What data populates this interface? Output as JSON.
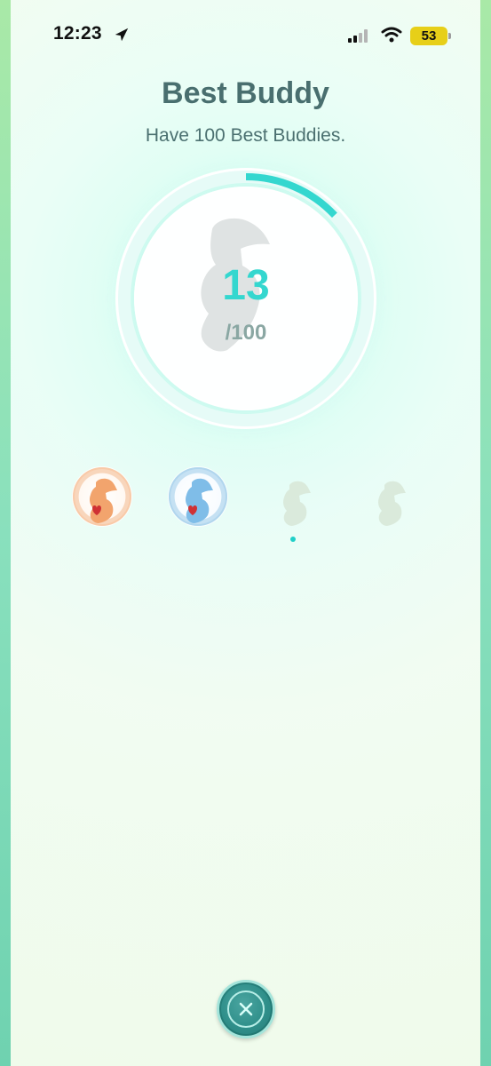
{
  "status_bar": {
    "time": "12:23",
    "battery": "53",
    "icons": [
      "location-arrow-icon",
      "cellular-signal-icon",
      "wifi-icon",
      "battery-icon"
    ]
  },
  "medal": {
    "title": "Best Buddy",
    "description": "Have 100 Best Buddies.",
    "current": "13",
    "goal": "/100",
    "progress_fraction": 0.13
  },
  "tiers": [
    {
      "name": "bronze",
      "state": "earned"
    },
    {
      "name": "silver",
      "state": "earned"
    },
    {
      "name": "gold",
      "state": "locked"
    },
    {
      "name": "platinum",
      "state": "locked"
    }
  ],
  "colors": {
    "accent": "#34d7cf",
    "title": "#496f6f",
    "bronze": "#f4b07a",
    "silver": "#8ec7ea",
    "close_button": "#2f8f8a"
  }
}
